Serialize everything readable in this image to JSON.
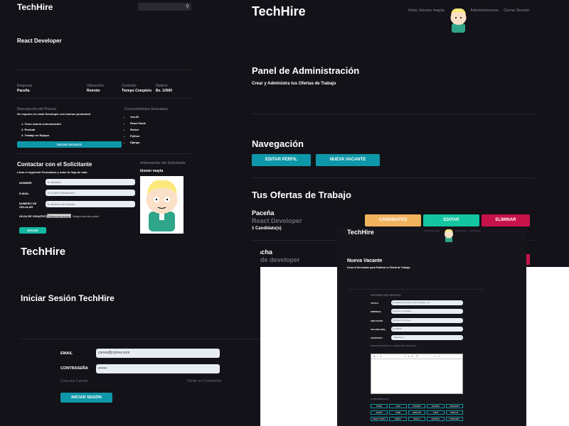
{
  "job_detail": {
    "brand": "TechHire",
    "search_placeholder": "",
    "job_title": "React Developer",
    "info_headers": [
      "Empresa",
      "Ubicación",
      "Contrato",
      "Salario"
    ],
    "info_values": [
      "Paceña",
      "Remoto",
      "Tiempo Completo",
      "Bs. 10000"
    ],
    "description_heading": "Descripción del Puesto",
    "description_text": "Se requiere un react Developer con buenos presuntuir",
    "description_items": [
      "1. Tener buena comunicación",
      "2. Puntual",
      "3. Trabajo en Equipo"
    ],
    "skills_heading": "Conocimientos Deseados",
    "skills": [
      "VueJS",
      "React Node",
      "Redux",
      "Python",
      "Django"
    ],
    "edit_button": "EDITAR VACANTE",
    "contact_heading": "Contactar con el Solicitante",
    "contact_sub": "Llena el siguiente Formulario y sube tu hoja de vida",
    "form_labels": [
      "NOMBRE",
      "E-MAIL",
      "NUMERO DE CELULAR",
      "HOJA DE VIDA(PDF)"
    ],
    "form_placeholders": [
      "Tu Nombre",
      "Tu Correo Electronico",
      "Tu Numero de Celular"
    ],
    "file_button": "Seleccionar archivo",
    "file_status": "Ningún archivo selec.",
    "send_button": "ENVIAR",
    "applicant_heading": "Información del Solicitante",
    "applicant_name": "bismer mayta"
  },
  "admin": {
    "brand": "TechHire",
    "greeting": "Hola: bismer mayta",
    "nav_admin": "Administracion",
    "nav_logout": "Cerrar Sesión",
    "panel_title": "Panel de Administración",
    "panel_sub": "Crear y Administra tus Ofertas de Trabajo",
    "nav_heading": "Navegación",
    "btn_edit_profile": "EDITAR PERFIL",
    "btn_new_vacancy": "NUEVA VACANTE",
    "offers_heading": "Tus Ofertas de Trabajo",
    "offers": [
      {
        "company": "Paceña",
        "title": "React Developer",
        "candidates": "1 Candidato(s)"
      },
      {
        "company": "Viacha",
        "title": "Node developer"
      }
    ],
    "btn_candidates": "CANDIDATOS",
    "btn_edit": "EDITAR",
    "btn_delete": "ELIMINAR"
  },
  "login": {
    "brand": "TechHire",
    "title": "Iniciar Sesión TechHire",
    "email_label": "EMAIL",
    "email_value": "correo@correo.com",
    "password_label": "CONTRASEÑA",
    "password_value": "•••••••",
    "create_account": "Crea una Cuenta",
    "forgot_password": "Olvide mi Contraseña",
    "submit": "INICIAR SESIÓN"
  },
  "new_vacancy": {
    "brand": "TechHire",
    "greeting": "Hola: bismer mayta",
    "nav_admin": "Administracion",
    "nav_logout": "Cerrar Sesión",
    "title": "Nueva Vacante",
    "subtitle": "Llena el formulario para Publicar tu Oferta de Trabajo",
    "section_general": "INFORMACIÓN GENERAL",
    "field_labels": [
      "TITULO",
      "EMPRESA",
      "UBICACIÓN",
      "SALARIO (BS)",
      "CONTRATO"
    ],
    "field_values": [
      "Ej. React Developer; Node Developer; etc",
      "Empresa o Liminada",
      "Ubicación o Remoto",
      "Ej. 500 Bs",
      "- Selecciona -"
    ],
    "section_description": "DESCRIPCIÓN DE LA OFERTA DE TRABAJO",
    "section_skills": "CONOCIMIENTOS",
    "skills": [
      "HTML5",
      "CSS3",
      "CSSGRID",
      "FLEXBOX",
      "JAVASCRIPT",
      "JQUERY",
      "NODE",
      "ANGULAR",
      "VUEJS",
      "REACTJS",
      "REACT HOOKS",
      "REDUX",
      "APOLLO",
      "GRAPHQL",
      "TYPESCRIPT"
    ]
  }
}
